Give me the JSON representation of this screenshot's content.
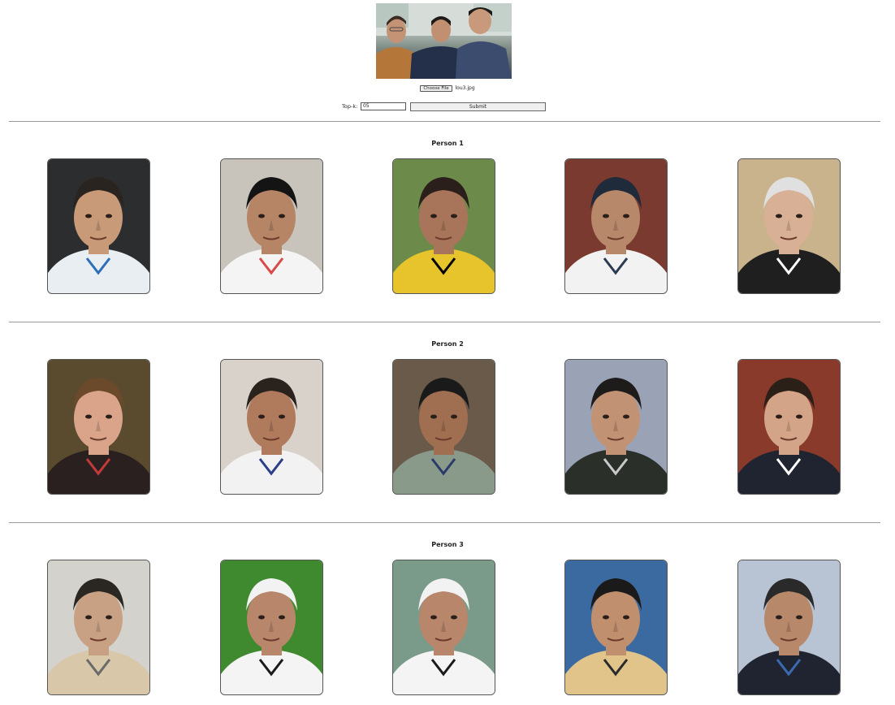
{
  "query": {
    "file_button_label": "Choose File",
    "file_name": "lou3.jpg",
    "topk_label": "Top-k:",
    "topk_value": "05",
    "submit_label": "Submit"
  },
  "persons": [
    {
      "title": "Person 1",
      "results": [
        {
          "bg": "#2b2d2f",
          "skin": "#c89a78",
          "hair": "#2a2420",
          "shirt": "#e9eef3",
          "accent": "#2f6fb7"
        },
        {
          "bg": "#c8c4bb",
          "skin": "#b58566",
          "hair": "#141414",
          "shirt": "#f4f4f4",
          "accent": "#d84a4a"
        },
        {
          "bg": "#6c8a4a",
          "skin": "#a8755a",
          "hair": "#2a1f1a",
          "shirt": "#e8c42c",
          "accent": "#000000"
        },
        {
          "bg": "#7b3a2f",
          "skin": "#b8886b",
          "hair": "#1f2a3a",
          "shirt": "#f2f2f2",
          "accent": "#2b3a52"
        },
        {
          "bg": "#c9b38c",
          "skin": "#d8b096",
          "hair": "#e0e0e0",
          "shirt": "#1f1f1f",
          "accent": "#ffffff"
        }
      ]
    },
    {
      "title": "Person 2",
      "results": [
        {
          "bg": "#5a4a2e",
          "skin": "#d9a48a",
          "hair": "#6a4a2a",
          "shirt": "#2a2020",
          "accent": "#c33a3a"
        },
        {
          "bg": "#d8d2ca",
          "skin": "#b07a5c",
          "hair": "#2a221c",
          "shirt": "#f2f2f2",
          "accent": "#2b3e8a"
        },
        {
          "bg": "#6a5a4a",
          "skin": "#a06e50",
          "hair": "#1a1a1a",
          "shirt": "#8a9a8a",
          "accent": "#2a3a6a"
        },
        {
          "bg": "#9aa3b5",
          "skin": "#c29274",
          "hair": "#1e1c1a",
          "shirt": "#2a2f2a",
          "accent": "#c9c9c9"
        },
        {
          "bg": "#8a3a2a",
          "skin": "#d4a488",
          "hair": "#2a2018",
          "shirt": "#1f2430",
          "accent": "#ffffff"
        }
      ]
    },
    {
      "title": "Person 3",
      "results": [
        {
          "bg": "#d4d2cc",
          "skin": "#c8a184",
          "hair": "#2a2622",
          "shirt": "#d8c7a8",
          "accent": "#6a6a6a"
        },
        {
          "bg": "#3f8a2e",
          "skin": "#b8866a",
          "hair": "#f2f2f2",
          "shirt": "#f4f4f4",
          "accent": "#1a1a1a"
        },
        {
          "bg": "#7a9a8a",
          "skin": "#b8866a",
          "hair": "#f2f2f2",
          "shirt": "#f4f4f4",
          "accent": "#1a1a1a"
        },
        {
          "bg": "#3a6aa0",
          "skin": "#c08f6e",
          "hair": "#1a1a1a",
          "shirt": "#e0c48a",
          "accent": "#2a2a2a"
        },
        {
          "bg": "#b8c4d4",
          "skin": "#b8886a",
          "hair": "#2a2a2a",
          "shirt": "#1f2430",
          "accent": "#3a6ab0"
        }
      ]
    }
  ]
}
